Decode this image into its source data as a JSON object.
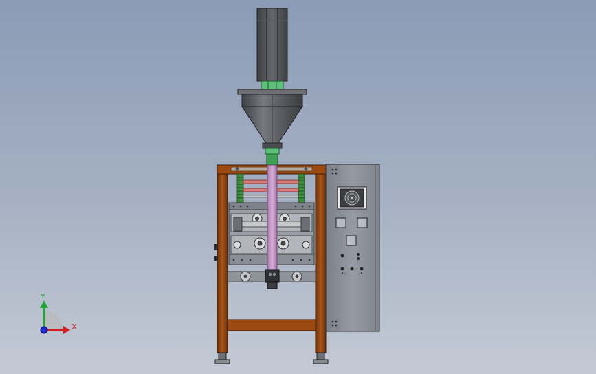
{
  "view": {
    "background_top": "#8b9bb6",
    "background_bottom": "#c4cad5"
  },
  "model": {
    "frame_color": "#9c4a12",
    "panel_color": "#8f939b",
    "hopper_color": "#5d5f64",
    "tube_color": "#c597c8",
    "spring_color": "#3e8f3c",
    "coupling_color": "#5cc07a"
  },
  "triad": {
    "x_label": "X",
    "y_label": "Y",
    "x_color": "#d32020",
    "y_color": "#1fa83a",
    "z_color": "#1f2ad0"
  }
}
